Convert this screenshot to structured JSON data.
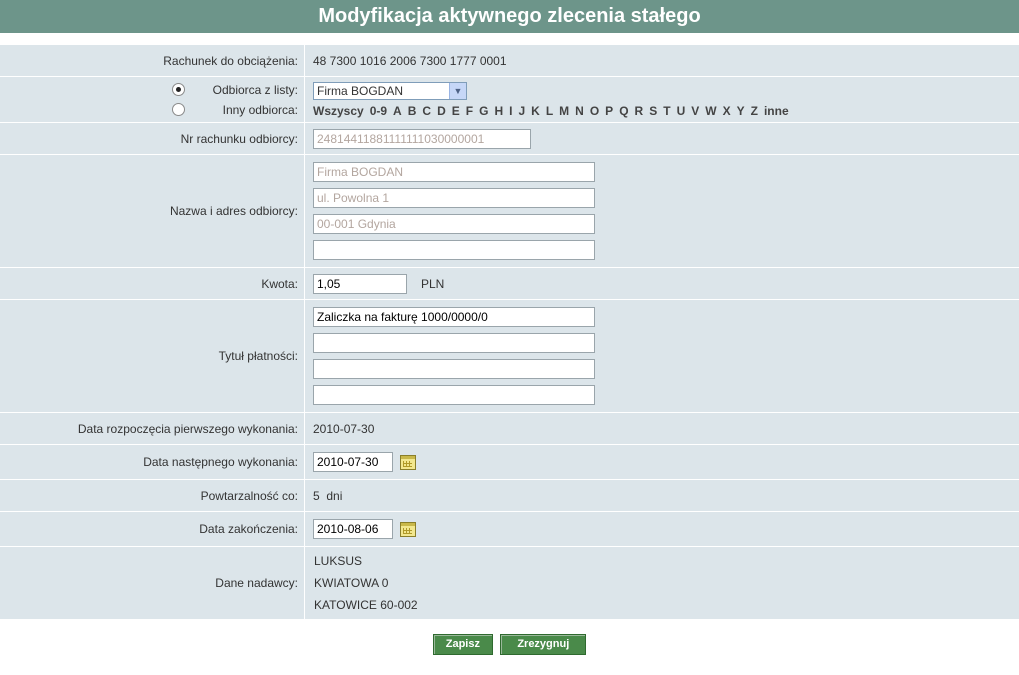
{
  "title": "Modyfikacja aktywnego zlecenia stałego",
  "account": {
    "label": "Rachunek do obciążenia:",
    "value": "48 7300 1016 2006 7300 1777 0001"
  },
  "recipient": {
    "from_list_label": "Odbiorca z listy:",
    "other_label": "Inny odbiorca:",
    "selected": "Firma BOGDAN",
    "filter_all": "Wszyscy",
    "filter_digits": "0-9",
    "letters": [
      "A",
      "B",
      "C",
      "D",
      "E",
      "F",
      "G",
      "H",
      "I",
      "J",
      "K",
      "L",
      "M",
      "N",
      "O",
      "P",
      "Q",
      "R",
      "S",
      "T",
      "U",
      "V",
      "W",
      "X",
      "Y",
      "Z"
    ],
    "filter_other": "inne"
  },
  "recipient_account": {
    "label": "Nr rachunku odbiorcy:",
    "value": "24814411881111111030000001"
  },
  "recipient_name": {
    "label": "Nazwa i adres odbiorcy:",
    "lines": [
      "Firma BOGDAN",
      "ul. Powolna 1",
      "00-001 Gdynia",
      ""
    ]
  },
  "amount": {
    "label": "Kwota:",
    "value": "1,05",
    "currency": "PLN"
  },
  "payment_title": {
    "label": "Tytuł płatności:",
    "lines": [
      "Zaliczka na fakturę 1000/0000/0",
      "",
      "",
      ""
    ]
  },
  "first_exec": {
    "label": "Data rozpoczęcia pierwszego wykonania:",
    "value": "2010-07-30"
  },
  "next_exec": {
    "label": "Data następnego wykonania:",
    "value": "2010-07-30"
  },
  "frequency": {
    "label": "Powtarzalność co:",
    "value": "5  dni"
  },
  "end_date": {
    "label": "Data zakończenia:",
    "value": "2010-08-06"
  },
  "sender": {
    "label": "Dane nadawcy:",
    "lines": [
      "LUKSUS",
      "KWIATOWA 0",
      "KATOWICE 60-002"
    ]
  },
  "buttons": {
    "save": "Zapisz",
    "cancel": "Zrezygnuj"
  }
}
